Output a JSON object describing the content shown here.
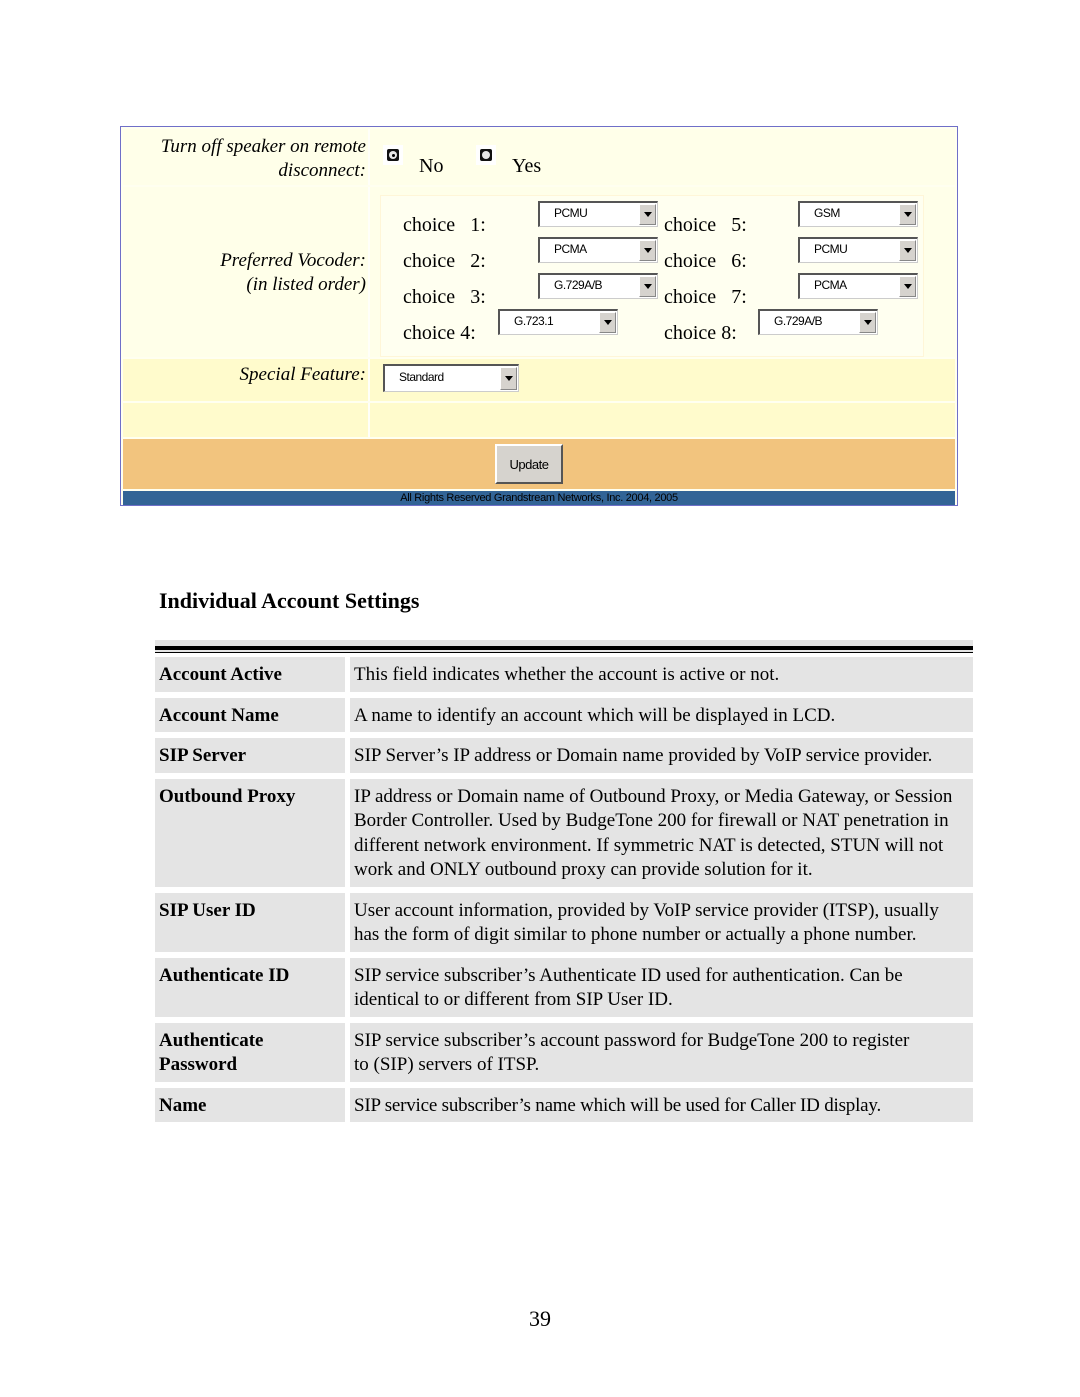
{
  "panel": {
    "speaker": {
      "label_line1": "Turn off speaker on remote",
      "label_line2": "disconnect:",
      "options": [
        {
          "label": "No",
          "selected": true
        },
        {
          "label": "Yes",
          "selected": false
        }
      ]
    },
    "vocoder": {
      "label_line1": "Preferred Vocoder:",
      "label_line2": "(in listed order)",
      "choices": [
        {
          "label": "choice   1:",
          "value": "PCMU"
        },
        {
          "label": "choice   2:",
          "value": "PCMA"
        },
        {
          "label": "choice   3:",
          "value": "G.729A/B"
        },
        {
          "label": "choice 4:",
          "value": "G.723.1"
        },
        {
          "label": "choice   5:",
          "value": "GSM"
        },
        {
          "label": "choice   6:",
          "value": "PCMU"
        },
        {
          "label": "choice   7:",
          "value": "PCMA"
        },
        {
          "label": "choice 8:",
          "value": "G.729A/B"
        }
      ]
    },
    "special_feature": {
      "label": "Special Feature:",
      "value": "Standard"
    },
    "update_label": "Update",
    "footer": "All Rights Reserved Grandstream Networks, Inc. 2004, 2005",
    "colors": {
      "border": "#6f6fc8",
      "row_light": "#ffffe9",
      "row_yellow": "#fffbcc",
      "row_orange": "#f2c47e",
      "footer_bar": "#326496"
    }
  },
  "section": {
    "title": "Individual Account Settings",
    "rows": [
      {
        "key": "Account Active",
        "desc": "This field indicates whether the account is active or not."
      },
      {
        "key": "Account Name",
        "desc": "A name to identify an account which will be displayed in LCD."
      },
      {
        "key": "SIP Server",
        "desc": "SIP Server’s IP address or Domain name provided by VoIP service provider."
      },
      {
        "key": "Outbound Proxy",
        "desc": "IP address or Domain name of Outbound Proxy, or Media Gateway, or Session Border Controller. Used by BudgeTone 200 for firewall or NAT penetration in different network environment. If symmetric NAT is detected, STUN will not work and ONLY outbound proxy can provide solution for it."
      },
      {
        "key": "SIP User ID",
        "desc": "User account information, provided by VoIP service provider (ITSP), usually has the form of digit similar to phone number or actually a phone number."
      },
      {
        "key": "Authenticate ID",
        "desc": "SIP service subscriber’s Authenticate ID used for authentication. Can be identical to or different from SIP User ID."
      },
      {
        "key": "Authenticate Password",
        "desc": "SIP service subscriber’s account password for BudgeTone 200 to register to (SIP) servers of ITSP."
      },
      {
        "key": "Name",
        "desc": "SIP service subscriber’s name which will be used for Caller ID display."
      }
    ]
  },
  "page_number": "39"
}
